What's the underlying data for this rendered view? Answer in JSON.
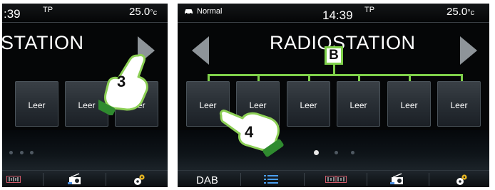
{
  "left_screen": {
    "time": ":39",
    "traffic": "TP",
    "temperature": "25.0",
    "temperature_unit": "°c",
    "station_title": "STATION",
    "presets": [
      "Leer",
      "Leer",
      "Leer"
    ],
    "step_number": "3"
  },
  "right_screen": {
    "status_label": "Normal",
    "time": "14:39",
    "traffic": "TP",
    "temperature": "25.0",
    "temperature_unit": "°c",
    "station_title": "RADIOSTATION",
    "callout_label": "B",
    "presets": [
      "Leer",
      "Leer",
      "Leer",
      "Leer",
      "Leer",
      "Leer"
    ],
    "step_number": "4",
    "bottom_bar": {
      "band_label": "DAB"
    }
  },
  "colors": {
    "accent_green": "#7fd04a",
    "background": "#050607",
    "preset_border": "#4a535a"
  },
  "icons": [
    "car-icon",
    "list-icon",
    "frequency-scale-icon",
    "radio-icon",
    "settings-gears-icon",
    "tap-hand-icon"
  ]
}
